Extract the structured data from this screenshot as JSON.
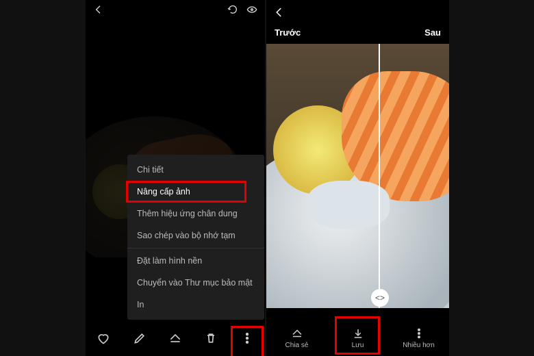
{
  "leftPhone": {
    "topbar": {
      "backIcon": "back",
      "refreshIcon": "refresh",
      "eyeIcon": "eye"
    },
    "menu": {
      "items": [
        {
          "label": "Chi tiết"
        },
        {
          "label": "Nâng cấp ảnh",
          "highlighted": true
        },
        {
          "label": "Thêm hiệu ứng chân dung"
        },
        {
          "label": "Sao chép vào bộ nhớ tạm"
        },
        {
          "divider": true
        },
        {
          "label": "Đặt làm hình nền"
        },
        {
          "label": "Chuyển vào Thư mục bảo mật"
        },
        {
          "label": "In"
        }
      ]
    },
    "bottombar": {
      "favorite": "heart",
      "edit": "pencil",
      "share": "share",
      "delete": "trash",
      "more": "more",
      "moreHighlighted": true
    }
  },
  "rightPhone": {
    "backIcon": "back",
    "compare": {
      "beforeLabel": "Trước",
      "afterLabel": "Sau",
      "sliderIcon": "<>"
    },
    "bottombar": {
      "share": {
        "icon": "share",
        "label": "Chia sẻ"
      },
      "save": {
        "icon": "download",
        "label": "Lưu",
        "highlighted": true
      },
      "more": {
        "icon": "more",
        "label": "Nhiều hơn"
      }
    }
  },
  "colors": {
    "highlight": "#e60000",
    "menuBg": "#1f1f1f"
  }
}
